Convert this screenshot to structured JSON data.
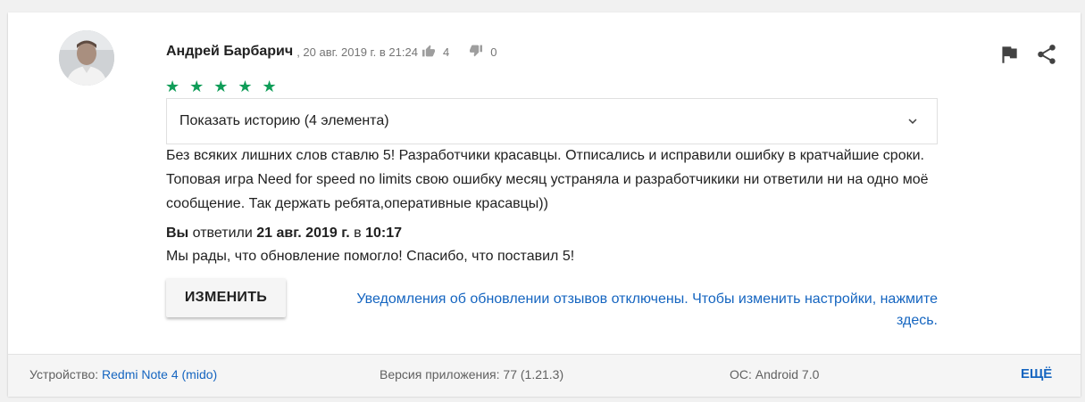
{
  "review": {
    "author": "Андрей Барбарич",
    "date": ", 20 авг. 2019 г. в 21:24",
    "upvotes": "4",
    "downvotes": "0",
    "rating": "★ ★ ★ ★ ★",
    "rating_value": 5,
    "history_label": "Показать историю (4 элемента)",
    "text": "Без всяких лишних слов ставлю 5! Разработчики красавцы. Отписались и исправили ошибку в кратчайшие сроки. Топовая игра Need for speed no limits свою ошибку месяц устраняла и разработчикики ни ответили ни на одно моё сообщение. Так держать ребята,оперативные красавцы))"
  },
  "reply": {
    "you": "Вы",
    "replied": "ответили",
    "date": "21 авг. 2019 г.",
    "at": "в",
    "time": "10:17",
    "text": "Мы рады, что обновление помогло! Спасибо, что поставил 5!"
  },
  "actions": {
    "edit_label": "ИЗМЕНИТЬ",
    "notice": "Уведомления об обновлении отзывов отключены. Чтобы изменить настройки, нажмите здесь."
  },
  "footer": {
    "device_label": "Устройство:",
    "device_value": "Redmi Note 4 (mido)",
    "version_label": "Версия приложения:",
    "version_value": "77 (1.21.3)",
    "os_label": "ОС:",
    "os_value": "Android 7.0",
    "more_label": "ЕЩЁ"
  },
  "icons": {
    "flag": "flag-icon",
    "share": "share-icon",
    "thumb_up": "thumb-up-icon",
    "thumb_down": "thumb-down-icon",
    "chevron": "chevron-down-icon"
  },
  "colors": {
    "star": "#0f9d58",
    "link": "#1565c0",
    "text": "#212121",
    "muted": "#757575"
  }
}
